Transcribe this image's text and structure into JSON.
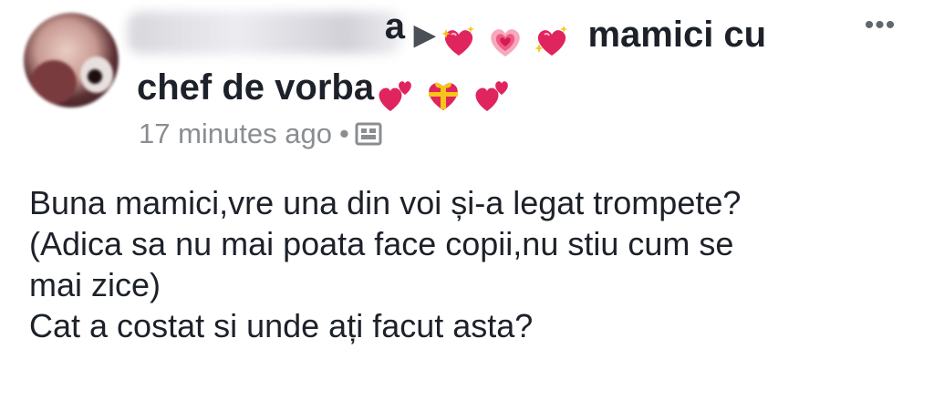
{
  "post": {
    "author_suffix": "a",
    "group_name_line1": "mamici cu",
    "group_name_line2": "chef de vorba",
    "timestamp": "17 minutes ago",
    "separator": "•",
    "audience_icon": "photo-icon",
    "more_label": "•••",
    "emojis_before": [
      "sparkling-heart",
      "growing-heart",
      "sparkling-heart"
    ],
    "emojis_after": [
      "two-hearts",
      "heart-with-ribbon",
      "two-hearts"
    ],
    "body_lines": [
      "Buna mamici,vre una din voi și-a legat trompete?",
      "(Adica sa nu mai poata face copii,nu stiu cum se",
      "mai zice)",
      "Cat a costat si unde ați facut asta?"
    ]
  },
  "colors": {
    "text": "#1d2129",
    "meta": "#8a8d91",
    "heart": "#e0245e"
  }
}
